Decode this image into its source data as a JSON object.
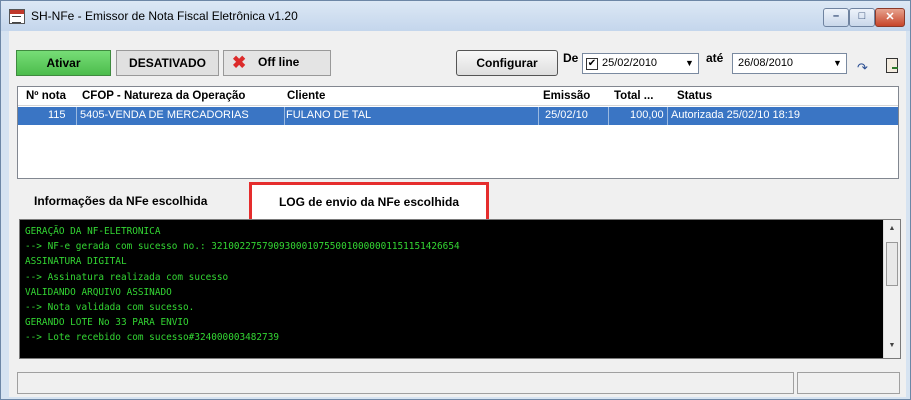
{
  "window": {
    "title": "SH-NFe - Emissor de Nota Fiscal Eletrônica v1.20",
    "minimize_glyph": "–",
    "maximize_glyph": "□",
    "close_glyph": "✕"
  },
  "toolbar": {
    "ativar_label": "Ativar",
    "status_label": "DESATIVADO",
    "offline_icon": "✖",
    "offline_label": "Off line",
    "configurar_label": "Configurar",
    "de_label": "De",
    "date_from": "25/02/2010",
    "ate_label": "até",
    "date_to": "26/08/2010",
    "checkbox_glyph": "✔",
    "dropdown_glyph": "▼",
    "refresh_glyph": "↷"
  },
  "grid": {
    "columns": [
      "Nº nota",
      "CFOP - Natureza da Operação",
      "Cliente",
      "Emissão",
      "Total ...",
      "Status"
    ],
    "rows": [
      {
        "numero": "115",
        "cfop": "5405-VENDA DE MERCADORIAS",
        "cliente": "FULANO DE TAL",
        "emissao": "25/02/10",
        "total": "100,00",
        "status": "Autorizada 25/02/10 18:19"
      }
    ]
  },
  "tabs": {
    "info_label": "Informações da NFe escolhida",
    "log_label": "LOG de envio da NFe escolhida"
  },
  "log": {
    "lines": [
      "GERAÇÃO DA NF-ELETRONICA",
      "--> NF-e gerada com sucesso no.: 32100227579093000107550010000001151151426654",
      "ASSINATURA DIGITAL",
      "--> Assinatura realizada com sucesso",
      "VALIDANDO ARQUIVO ASSINADO",
      "--> Nota validada com sucesso.",
      "GERANDO LOTE No 33 PARA ENVIO",
      "--> Lote recebido com sucesso#324000003482739"
    ],
    "scroll_up_glyph": "▲",
    "scroll_down_glyph": "▼"
  },
  "colors": {
    "selection": "#3a75c4",
    "log_text": "#33d633",
    "highlight": "#e52d2d",
    "ativar": "#4cbc4c"
  }
}
